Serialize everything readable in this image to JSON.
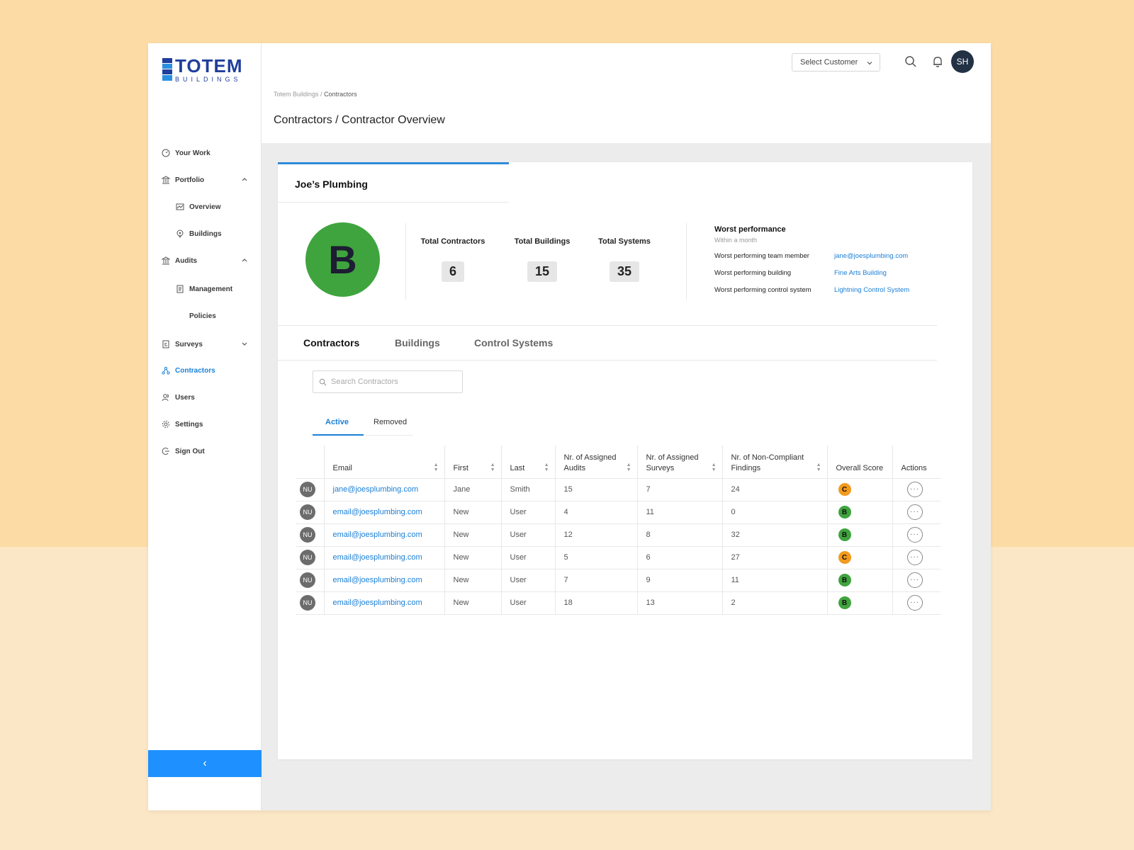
{
  "brand": {
    "name_top": "TOTEM",
    "name_bottom": "BUILDINGS"
  },
  "sidebar": {
    "items": [
      {
        "label": "Your Work"
      },
      {
        "label": "Portfolio"
      },
      {
        "label": "Overview"
      },
      {
        "label": "Buildings"
      },
      {
        "label": "Audits"
      },
      {
        "label": "Management"
      },
      {
        "label": "Policies"
      },
      {
        "label": "Surveys"
      },
      {
        "label": "Contractors"
      },
      {
        "label": "Users"
      },
      {
        "label": "Settings"
      },
      {
        "label": "Sign Out"
      }
    ],
    "collapse_label": "‹"
  },
  "header": {
    "select_customer": "Select Customer",
    "avatar_initials": "SH",
    "breadcrumb_root": "Totem Buildings",
    "breadcrumb_sep": " / ",
    "breadcrumb_current": "Contractors",
    "title": "Contractors / Contractor Overview"
  },
  "overview": {
    "company": "Joe’s Plumbing",
    "grade": "B",
    "stats": [
      {
        "label": "Total Contractors",
        "value": "6"
      },
      {
        "label": "Total Buildings",
        "value": "15"
      },
      {
        "label": "Total Systems",
        "value": "35"
      }
    ],
    "worst": {
      "title": "Worst performance",
      "subtitle": "Within a month",
      "rows": [
        {
          "label": "Worst performing team member",
          "value": "jane@joesplumbing.com"
        },
        {
          "label": "Worst performing building",
          "value": "Fine Arts Building"
        },
        {
          "label": "Worst performing control system",
          "value": "Lightning Control System"
        }
      ]
    }
  },
  "tabs": [
    "Contractors",
    "Buildings",
    "Control Systems"
  ],
  "search": {
    "placeholder": "Search Contractors"
  },
  "subtabs": [
    "Active",
    "Removed"
  ],
  "table": {
    "columns": [
      "Email",
      "First",
      "Last",
      "Nr. of Assigned Audits",
      "Nr. of Assigned Surveys",
      "Nr. of Non-Compliant Findings",
      "Overall Score",
      "Actions"
    ],
    "rows": [
      {
        "avatar": "NU",
        "email": "jane@joesplumbing.com",
        "first": "Jane",
        "last": "Smith",
        "audits": "15",
        "surveys": "7",
        "findings": "24",
        "score": "C",
        "score_color": "#f39a1e"
      },
      {
        "avatar": "NU",
        "email": "email@joesplumbing.com",
        "first": "New",
        "last": "User",
        "audits": "4",
        "surveys": "11",
        "findings": "0",
        "score": "B",
        "score_color": "#3fa43e"
      },
      {
        "avatar": "NU",
        "email": "email@joesplumbing.com",
        "first": "New",
        "last": "User",
        "audits": "12",
        "surveys": "8",
        "findings": "32",
        "score": "B",
        "score_color": "#3fa43e"
      },
      {
        "avatar": "NU",
        "email": "email@joesplumbing.com",
        "first": "New",
        "last": "User",
        "audits": "5",
        "surveys": "6",
        "findings": "27",
        "score": "C",
        "score_color": "#f39a1e"
      },
      {
        "avatar": "NU",
        "email": "email@joesplumbing.com",
        "first": "New",
        "last": "User",
        "audits": "7",
        "surveys": "9",
        "findings": "11",
        "score": "B",
        "score_color": "#3fa43e"
      },
      {
        "avatar": "NU",
        "email": "email@joesplumbing.com",
        "first": "New",
        "last": "User",
        "audits": "18",
        "surveys": "13",
        "findings": "2",
        "score": "B",
        "score_color": "#3fa43e"
      }
    ],
    "actions_glyph": "···"
  },
  "colors": {
    "accent": "#1a7fd6",
    "grade_b": "#3fa43e",
    "grade_c": "#f39a1e",
    "collapse_bar": "#1e90ff"
  }
}
